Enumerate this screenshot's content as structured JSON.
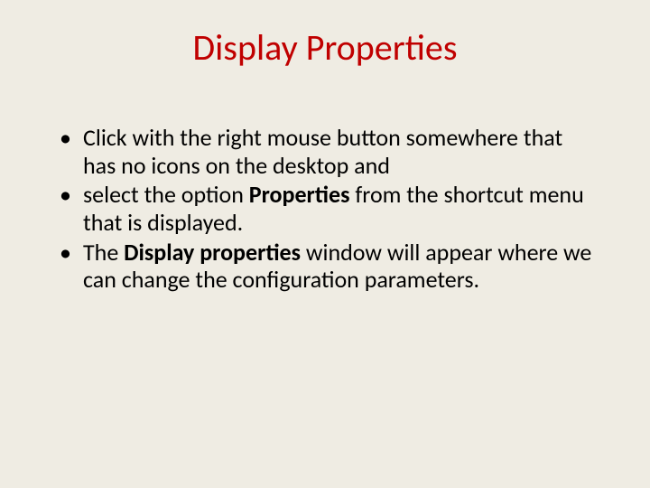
{
  "title": "Display Properties",
  "bullets": {
    "b1": "Click with the right mouse button somewhere that has no icons on the desktop and",
    "b2a": "select the option ",
    "b2b": "Properties",
    "b2c": " from the shortcut menu that is displayed.",
    "b3a": "The ",
    "b3b": "Display properties",
    "b3c": " window will appear where we can change the configuration parameters."
  }
}
